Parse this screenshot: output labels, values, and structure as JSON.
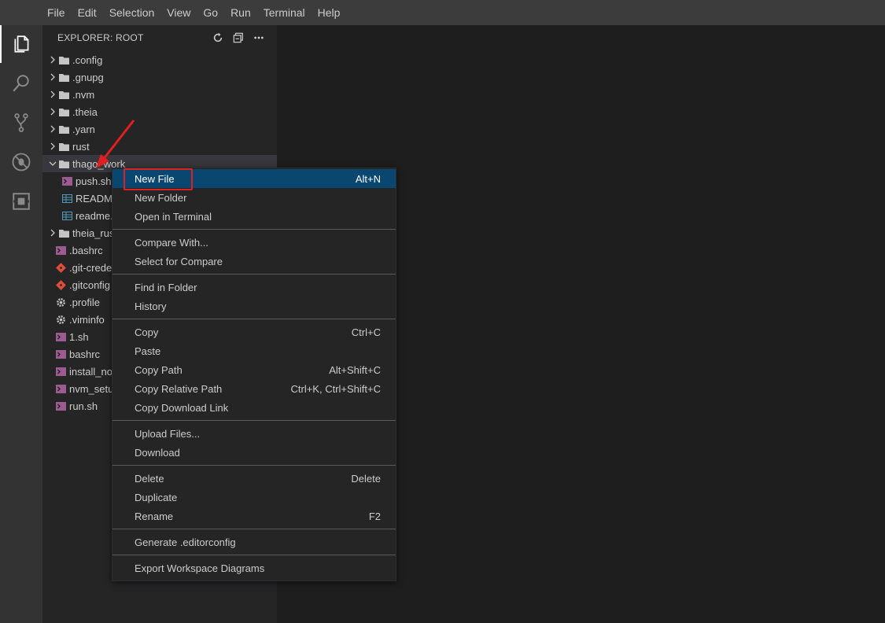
{
  "menubar": {
    "items": [
      "File",
      "Edit",
      "Selection",
      "View",
      "Go",
      "Run",
      "Terminal",
      "Help"
    ]
  },
  "activity_bar": {
    "icons": [
      "files-icon",
      "search-icon",
      "source-control-icon",
      "debug-icon",
      "extensions-icon"
    ]
  },
  "explorer": {
    "title": "EXPLORER: ROOT",
    "actions": [
      "refresh-icon",
      "collapse-all-icon",
      "more-actions-icon"
    ],
    "tree": [
      {
        "label": ".config",
        "kind": "folder",
        "expanded": false,
        "indent": 0
      },
      {
        "label": ".gnupg",
        "kind": "folder",
        "expanded": false,
        "indent": 0
      },
      {
        "label": ".nvm",
        "kind": "folder",
        "expanded": false,
        "indent": 0
      },
      {
        "label": ".theia",
        "kind": "folder",
        "expanded": false,
        "indent": 0
      },
      {
        "label": ".yarn",
        "kind": "folder",
        "expanded": false,
        "indent": 0
      },
      {
        "label": "rust",
        "kind": "folder",
        "expanded": false,
        "indent": 0
      },
      {
        "label": "thago_work",
        "kind": "folder",
        "expanded": true,
        "indent": 0,
        "selected": true
      },
      {
        "label": "push.sh",
        "kind": "shell",
        "indent": 1
      },
      {
        "label": "READM",
        "kind": "markdown",
        "indent": 1
      },
      {
        "label": "readme.",
        "kind": "markdown",
        "indent": 1
      },
      {
        "label": "theia_rus",
        "kind": "folder",
        "expanded": false,
        "indent": 0
      },
      {
        "label": ".bashrc",
        "kind": "shell",
        "indent": 0
      },
      {
        "label": ".git-crede",
        "kind": "git",
        "indent": 0
      },
      {
        "label": ".gitconfig",
        "kind": "git",
        "indent": 0
      },
      {
        "label": ".profile",
        "kind": "gear",
        "indent": 0
      },
      {
        "label": ".viminfo",
        "kind": "gear",
        "indent": 0
      },
      {
        "label": "1.sh",
        "kind": "shell",
        "indent": 0
      },
      {
        "label": "bashrc",
        "kind": "shell",
        "indent": 0
      },
      {
        "label": "install_no",
        "kind": "shell",
        "indent": 0
      },
      {
        "label": "nvm_setu",
        "kind": "shell",
        "indent": 0
      },
      {
        "label": "run.sh",
        "kind": "shell",
        "indent": 0
      }
    ]
  },
  "context_menu": {
    "groups": [
      [
        {
          "label": "New File",
          "shortcut": "Alt+N",
          "highlighted": true
        },
        {
          "label": "New Folder",
          "shortcut": ""
        },
        {
          "label": "Open in Terminal",
          "shortcut": ""
        }
      ],
      [
        {
          "label": "Compare With...",
          "shortcut": ""
        },
        {
          "label": "Select for Compare",
          "shortcut": ""
        }
      ],
      [
        {
          "label": "Find in Folder",
          "shortcut": ""
        },
        {
          "label": "History",
          "shortcut": ""
        }
      ],
      [
        {
          "label": "Copy",
          "shortcut": "Ctrl+C"
        },
        {
          "label": "Paste",
          "shortcut": ""
        },
        {
          "label": "Copy Path",
          "shortcut": "Alt+Shift+C"
        },
        {
          "label": "Copy Relative Path",
          "shortcut": "Ctrl+K, Ctrl+Shift+C"
        },
        {
          "label": "Copy Download Link",
          "shortcut": ""
        }
      ],
      [
        {
          "label": "Upload Files...",
          "shortcut": ""
        },
        {
          "label": "Download",
          "shortcut": ""
        }
      ],
      [
        {
          "label": "Delete",
          "shortcut": "Delete"
        },
        {
          "label": "Duplicate",
          "shortcut": ""
        },
        {
          "label": "Rename",
          "shortcut": "F2"
        }
      ],
      [
        {
          "label": "Generate .editorconfig",
          "shortcut": ""
        }
      ],
      [
        {
          "label": "Export Workspace Diagrams",
          "shortcut": ""
        }
      ]
    ]
  },
  "colors": {
    "menubar_bg": "#3c3c3c",
    "activity_bg": "#333333",
    "sidebar_bg": "#252526",
    "editor_bg": "#1e1e1e",
    "highlight_bg": "#094771",
    "annotation_red": "#e02020"
  }
}
